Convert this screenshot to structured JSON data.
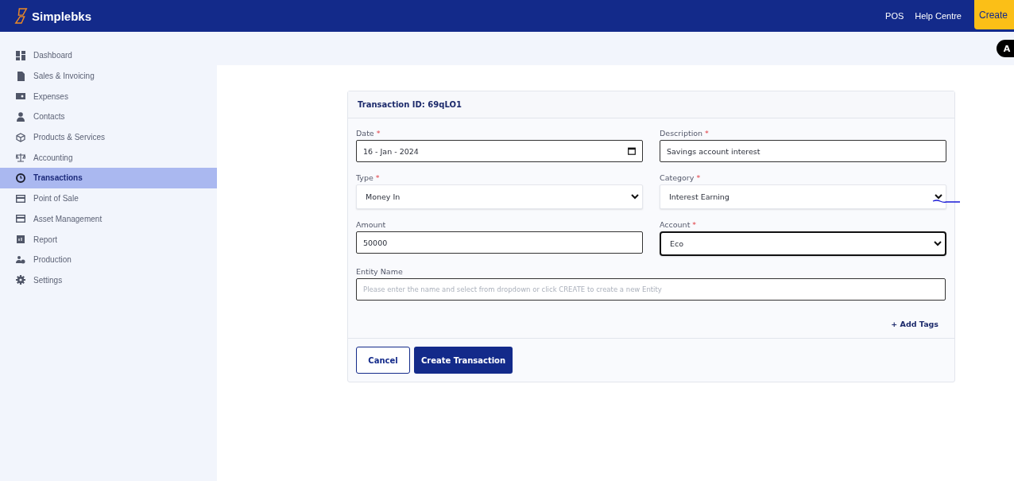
{
  "header": {
    "brand": "Simplebks",
    "links": [
      "POS",
      "Help Centre"
    ],
    "create_button": "Create",
    "avatar": "A"
  },
  "sidebar": {
    "items": [
      {
        "label": "Dashboard",
        "kind": "dashboard",
        "selected": false
      },
      {
        "label": "Sales & Invoicing",
        "kind": "file",
        "selected": false
      },
      {
        "label": "Expenses",
        "kind": "cash",
        "selected": false
      },
      {
        "label": "Contacts",
        "kind": "person",
        "selected": false
      },
      {
        "label": "Products & Services",
        "kind": "box",
        "selected": false
      },
      {
        "label": "Accounting",
        "kind": "scale",
        "selected": false
      },
      {
        "label": "Transactions",
        "kind": "clock",
        "selected": true
      },
      {
        "label": "Point of Sale",
        "kind": "card",
        "selected": false
      },
      {
        "label": "Asset Management",
        "kind": "card",
        "selected": false
      },
      {
        "label": "Report",
        "kind": "report",
        "selected": false
      },
      {
        "label": "Production",
        "kind": "people",
        "selected": false
      },
      {
        "label": "Settings",
        "kind": "gear",
        "selected": false
      }
    ]
  },
  "form": {
    "title": "Transaction ID: 69qLO1",
    "fields": [
      {
        "label": "Date",
        "required_mark": "*",
        "kind": "date",
        "value": "16 - Jan - 2024",
        "focused": false
      },
      {
        "label": "Description",
        "required_mark": "*",
        "kind": "text",
        "value": "Savings account interest",
        "focused": false
      },
      {
        "label": "Type",
        "required_mark": "*",
        "kind": "select",
        "value": "Money In",
        "focused": false
      },
      {
        "label": "Category",
        "required_mark": "*",
        "kind": "select",
        "value": "Interest Earning",
        "focused": false
      },
      {
        "label": "Amount",
        "kind": "text",
        "value": "50000",
        "focused": false
      },
      {
        "label": "Account",
        "required_mark": "*",
        "kind": "select",
        "value": "Eco",
        "focused": true
      },
      {
        "label": "Entity Name",
        "kind": "wide",
        "placeholder": "Please enter the name and select from dropdown or click CREATE to create a new Entity",
        "focused": false
      }
    ],
    "add_tags": "+ Add Tags",
    "buttons": [
      "Cancel",
      "Create Transaction"
    ]
  }
}
